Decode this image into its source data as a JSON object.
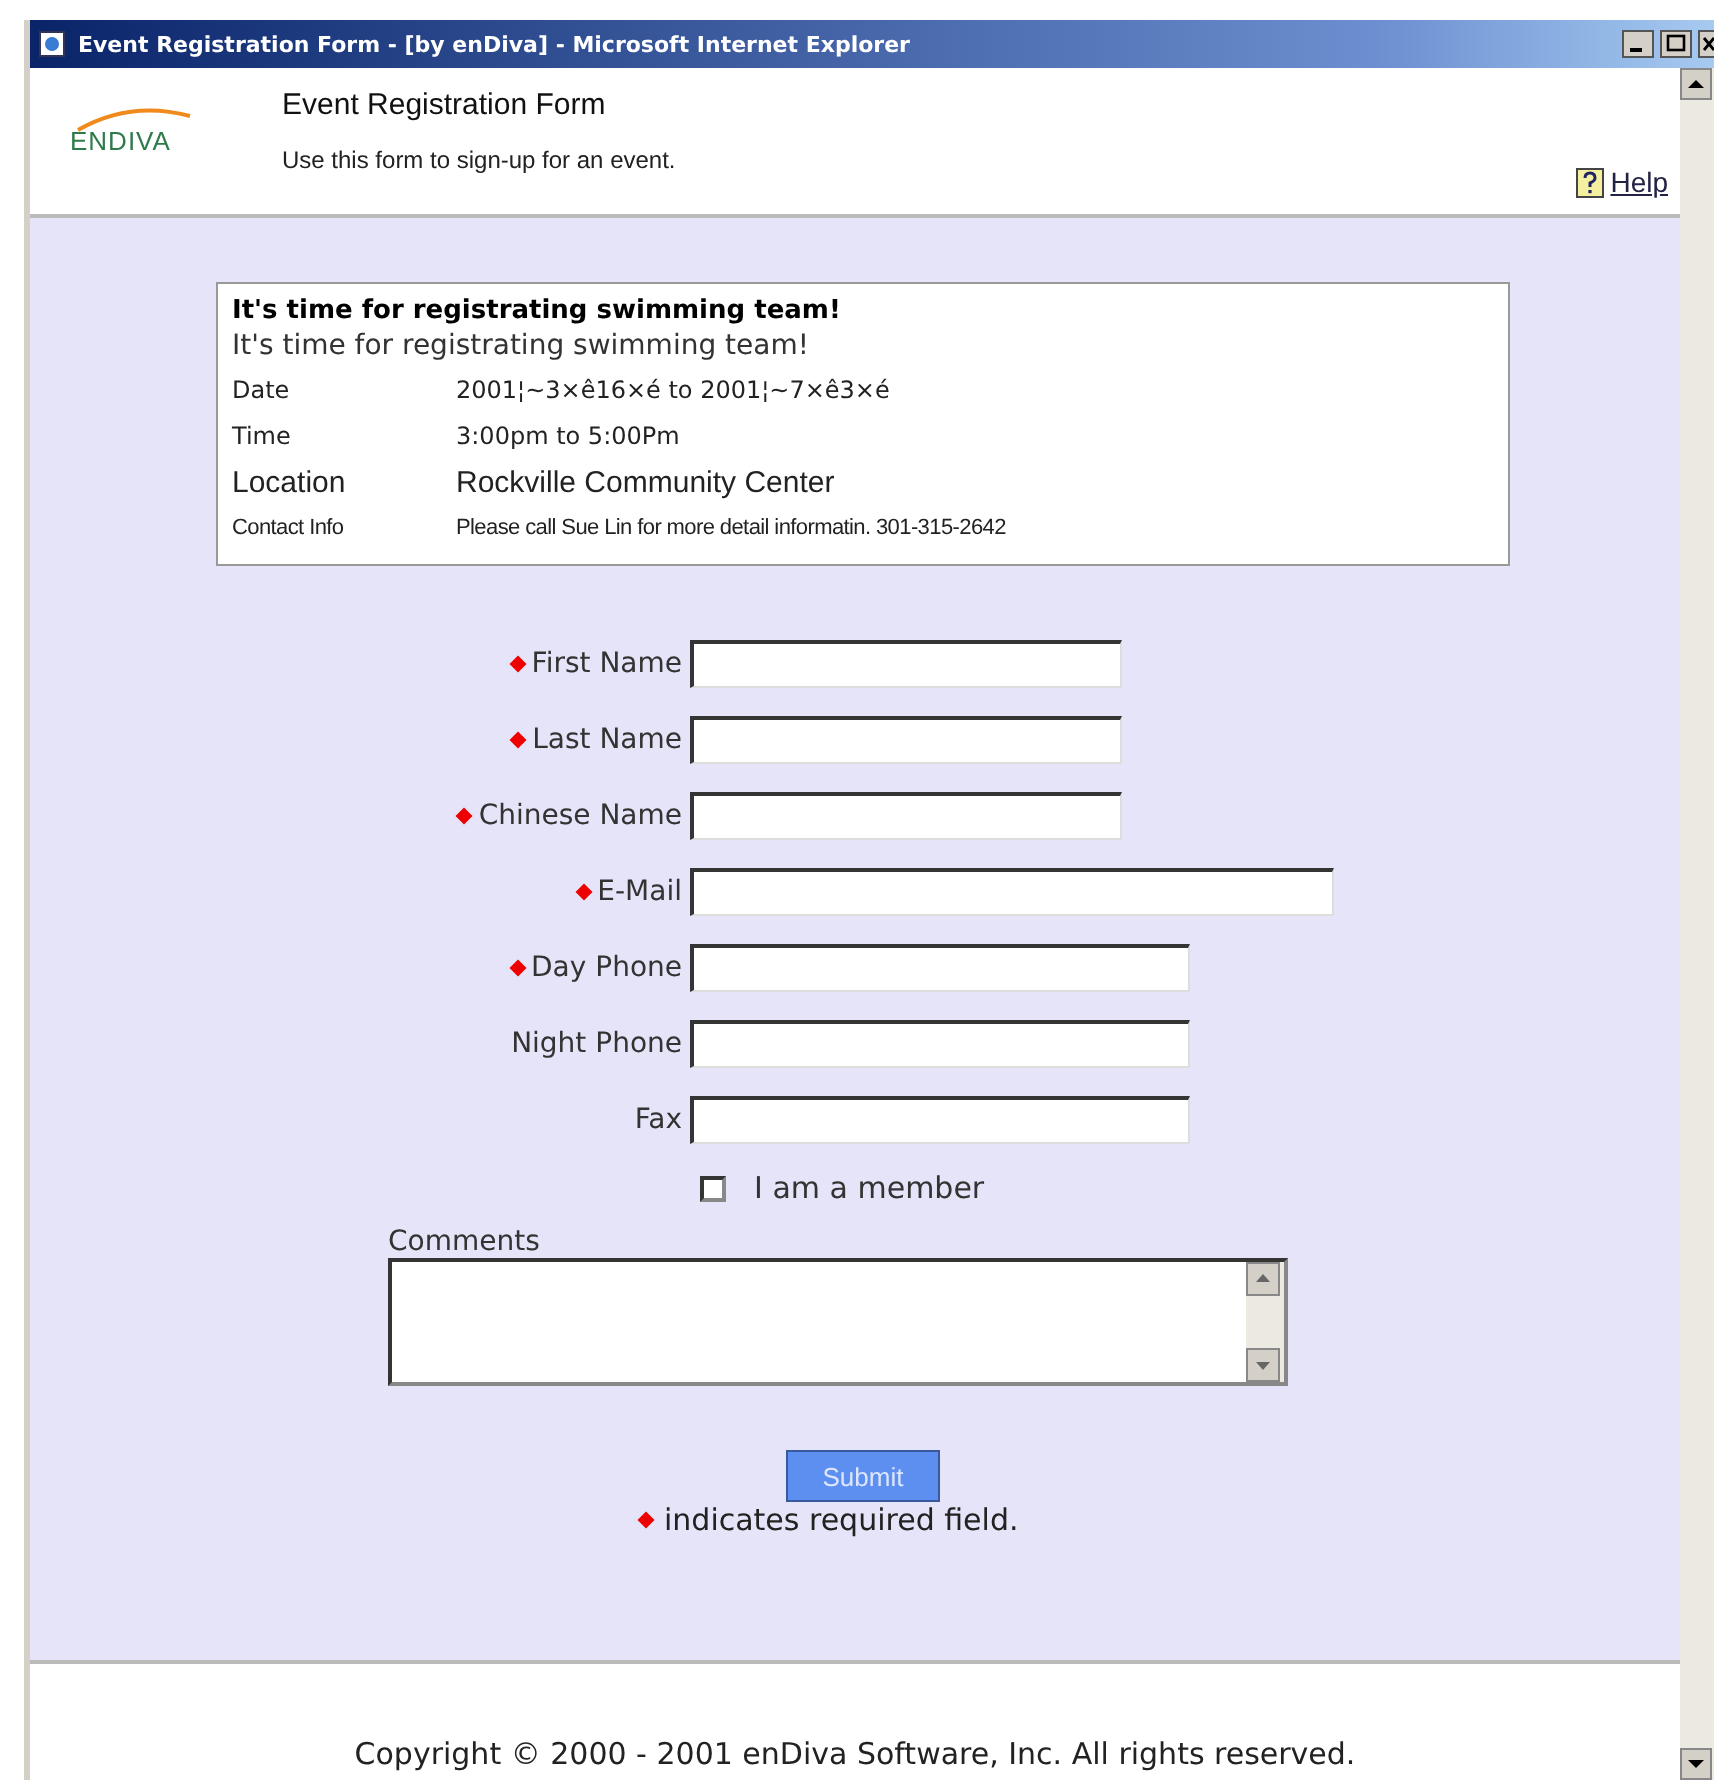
{
  "window": {
    "title": "Event Registration Form - [by enDiva] - Microsoft Internet Explorer"
  },
  "header": {
    "logo": "ENDIVA",
    "title": "Event Registration Form",
    "subtitle": "Use this form to sign-up for an event.",
    "help": "Help"
  },
  "event": {
    "heading": "It's time for registrating swimming team!",
    "description": "It's time for registrating swimming team!",
    "details": [
      {
        "label": "Date",
        "value": "2001¦~3×ê16×é to 2001¦~7×ê3×é",
        "kind": "normal"
      },
      {
        "label": "Time",
        "value": "3:00pm to 5:00Pm",
        "kind": "normal"
      },
      {
        "label": "Location",
        "value": "Rockville Community Center",
        "kind": "large"
      },
      {
        "label": "Contact Info",
        "value": "Please call Sue Lin for more detail informatin. 301-315-2642",
        "kind": "small"
      }
    ]
  },
  "fields": [
    {
      "label": "First Name",
      "required": true
    },
    {
      "label": "Last Name",
      "required": true
    },
    {
      "label": "Chinese Name",
      "required": true
    },
    {
      "label": "E-Mail",
      "required": true
    },
    {
      "label": "Day Phone",
      "required": true
    },
    {
      "label": "Night Phone",
      "required": false
    },
    {
      "label": "Fax",
      "required": false
    }
  ],
  "member": {
    "label": "I am a member",
    "checked": false
  },
  "comments": {
    "label": "Comments"
  },
  "submit": "Submit",
  "required_note": "indicates required field.",
  "footer": "Copyright © 2000 - 2001  enDiva Software, Inc.  All rights reserved."
}
